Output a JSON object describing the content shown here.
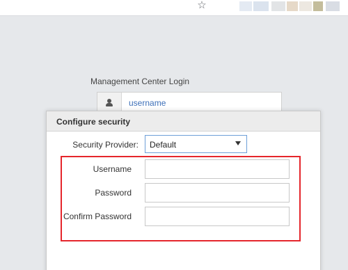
{
  "browser": {
    "star_icon": "star-icon",
    "extension_colors": [
      "#e4eaf3",
      "#dbe3ee",
      "#e2e4e6",
      "#e6d9c8",
      "#ede8e1",
      "#c4bd9c",
      "#d9dde4"
    ]
  },
  "login": {
    "title": "Management Center Login",
    "username_value": "username",
    "user_icon": "user-icon"
  },
  "dialog": {
    "title": "Configure security",
    "security_provider_label": "Security Provider:",
    "security_provider_value": "Default",
    "username_label": "Username",
    "username_value": "",
    "password_label": "Password",
    "password_value": "",
    "confirm_password_label": "Confirm Password",
    "confirm_password_value": "",
    "highlight_color": "#e5252b"
  }
}
